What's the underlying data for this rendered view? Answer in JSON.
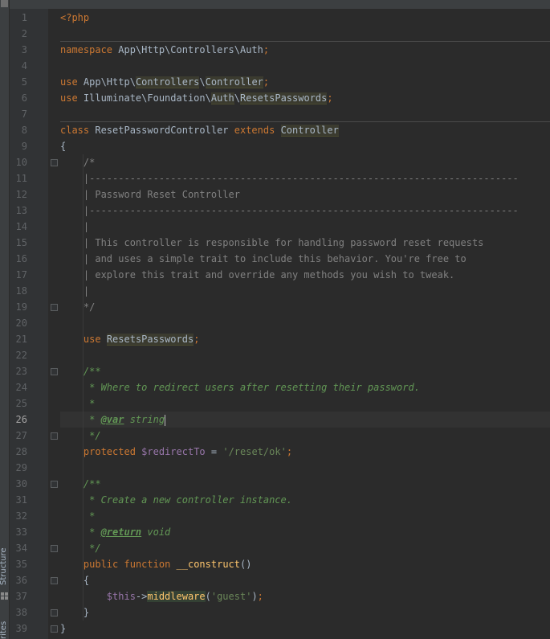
{
  "sidebar": {
    "structure_label": "Structure",
    "favorites_label": "rites"
  },
  "editor": {
    "language": "php",
    "current_line": 26,
    "lines": [
      {
        "n": "1",
        "text": "<?php"
      },
      {
        "n": "2",
        "text": ""
      },
      {
        "n": "3",
        "text": "namespace App\\Http\\Controllers\\Auth;"
      },
      {
        "n": "4",
        "text": ""
      },
      {
        "n": "5",
        "text": "use App\\Http\\Controllers\\Controller;"
      },
      {
        "n": "6",
        "text": "use Illuminate\\Foundation\\Auth\\ResetsPasswords;"
      },
      {
        "n": "7",
        "text": ""
      },
      {
        "n": "8",
        "text": "class ResetPasswordController extends Controller"
      },
      {
        "n": "9",
        "text": "{"
      },
      {
        "n": "10",
        "text": "    /*"
      },
      {
        "n": "11",
        "text": "    |--------------------------------------------------------------------------"
      },
      {
        "n": "12",
        "text": "    | Password Reset Controller"
      },
      {
        "n": "13",
        "text": "    |--------------------------------------------------------------------------"
      },
      {
        "n": "14",
        "text": "    |"
      },
      {
        "n": "15",
        "text": "    | This controller is responsible for handling password reset requests"
      },
      {
        "n": "16",
        "text": "    | and uses a simple trait to include this behavior. You're free to"
      },
      {
        "n": "17",
        "text": "    | explore this trait and override any methods you wish to tweak."
      },
      {
        "n": "18",
        "text": "    |"
      },
      {
        "n": "19",
        "text": "    */"
      },
      {
        "n": "20",
        "text": ""
      },
      {
        "n": "21",
        "text": "    use ResetsPasswords;"
      },
      {
        "n": "22",
        "text": ""
      },
      {
        "n": "23",
        "text": "    /**"
      },
      {
        "n": "24",
        "text": "     * Where to redirect users after resetting their password."
      },
      {
        "n": "25",
        "text": "     *"
      },
      {
        "n": "26",
        "text": "     * @var string"
      },
      {
        "n": "27",
        "text": "     */"
      },
      {
        "n": "28",
        "text": "    protected $redirectTo = '/reset/ok';"
      },
      {
        "n": "29",
        "text": ""
      },
      {
        "n": "30",
        "text": "    /**"
      },
      {
        "n": "31",
        "text": "     * Create a new controller instance."
      },
      {
        "n": "32",
        "text": "     *"
      },
      {
        "n": "33",
        "text": "     * @return void"
      },
      {
        "n": "34",
        "text": "     */"
      },
      {
        "n": "35",
        "text": "    public function __construct()"
      },
      {
        "n": "36",
        "text": "    {"
      },
      {
        "n": "37",
        "text": "        $this->middleware('guest');"
      },
      {
        "n": "38",
        "text": "    }"
      },
      {
        "n": "39",
        "text": "}"
      }
    ]
  },
  "colors": {
    "background": "#2b2b2b",
    "gutter": "#313335",
    "keyword": "#cc7832",
    "comment": "#808080",
    "doc_comment": "#629755",
    "string": "#6a8759",
    "variable": "#9876aa",
    "function": "#ffc66d",
    "text": "#a9b7c6"
  }
}
